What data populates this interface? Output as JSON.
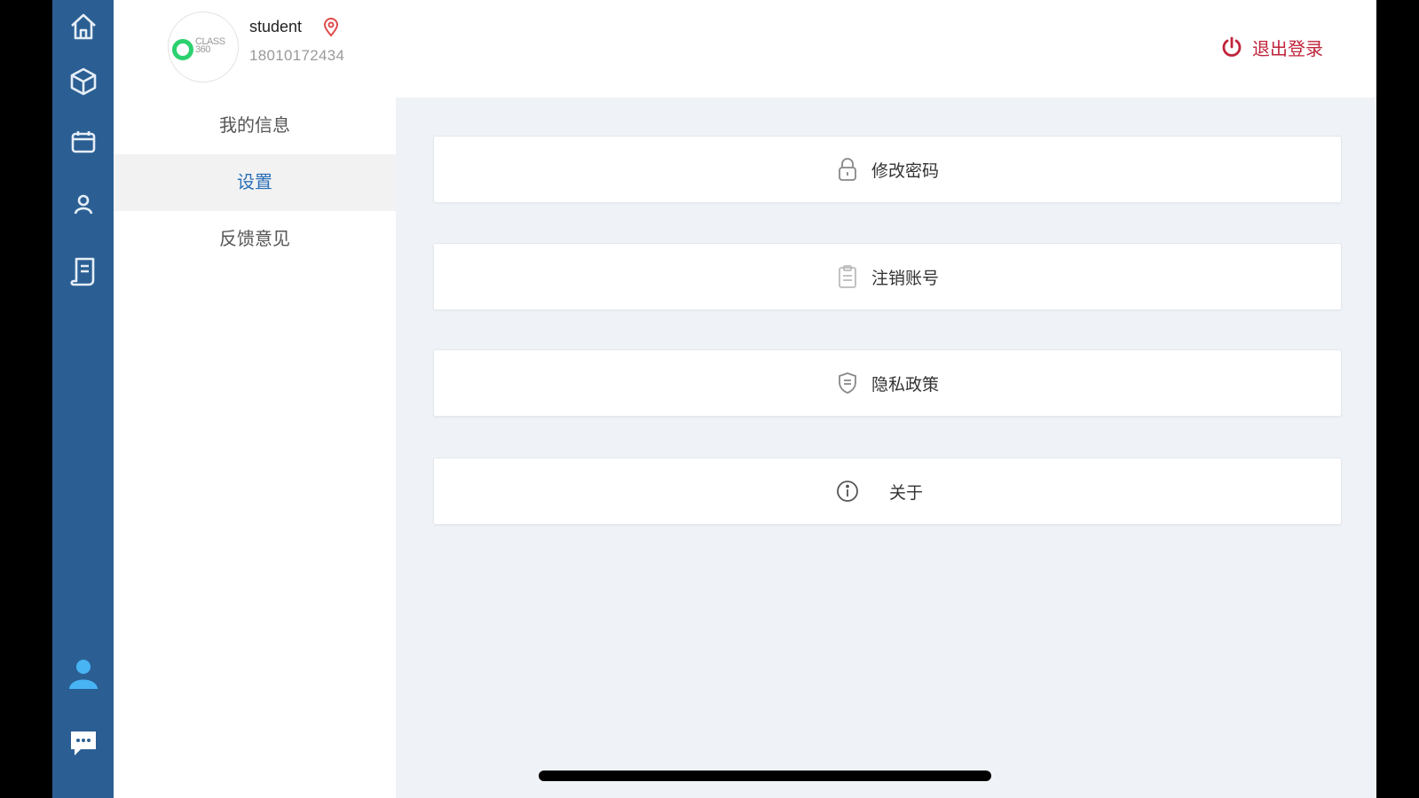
{
  "user": {
    "name": "student",
    "phone": "18010172434",
    "avatar_text": "CLASS 360"
  },
  "header": {
    "logout_label": "退出登录"
  },
  "submenu": {
    "items": [
      {
        "label": "我的信息",
        "active": false
      },
      {
        "label": "设置",
        "active": true
      },
      {
        "label": "反馈意见",
        "active": false
      }
    ]
  },
  "settings": {
    "items": [
      {
        "label": "修改密码",
        "icon": "lock-icon"
      },
      {
        "label": "注销账号",
        "icon": "clipboard-icon"
      },
      {
        "label": "隐私政策",
        "icon": "shield-icon"
      },
      {
        "label": "关于",
        "icon": "info-icon"
      }
    ]
  },
  "nav_rail": {
    "icons": [
      "home-icon",
      "cube-icon",
      "calendar-icon",
      "person-icon",
      "document-icon",
      "profile-icon",
      "chat-icon"
    ]
  },
  "colors": {
    "rail": "#2b5f93",
    "accent": "#2a70b8",
    "logout": "#c0233b",
    "background": "#eff3f7"
  }
}
